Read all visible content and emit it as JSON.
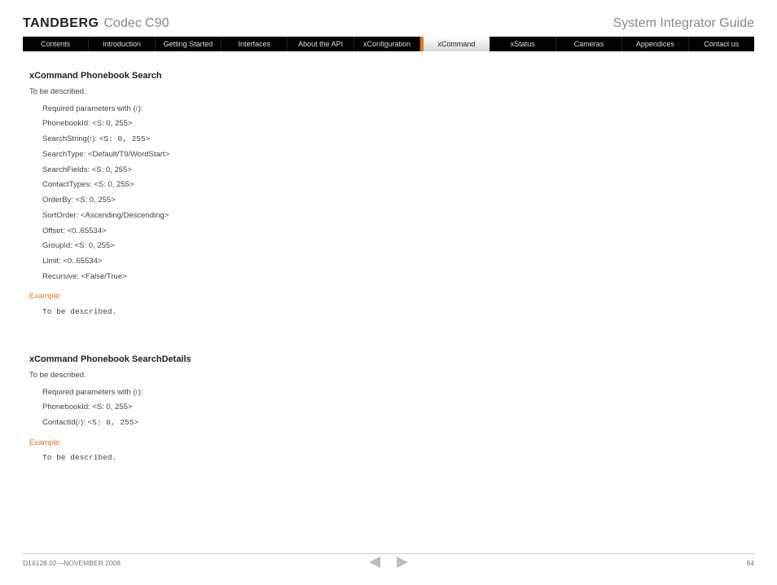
{
  "header": {
    "brand": "TANDBERG",
    "product": "Codec C90",
    "guide": "System Integrator Guide"
  },
  "nav": {
    "items": [
      "Contents",
      "Introduction",
      "Getting Started",
      "Interfaces",
      "About the API",
      "xConfiguration",
      "xCommand",
      "xStatus",
      "Cameras",
      "Appendices",
      "Contact us"
    ],
    "active_index": 6
  },
  "section1": {
    "title": "xCommand Phonebook Search",
    "desc": "To be described.",
    "req_label_pre": "Required parameters with (",
    "req_label_r": "r",
    "req_label_post": "):",
    "params": [
      {
        "text": "PhonebookId: <S: 0, 255>"
      },
      {
        "pre": "SearchString(",
        "r": "r",
        "post": "):  ",
        "mono": "<S: 0, 255>"
      },
      {
        "text": "SearchType: <Default/T9/WordStart>"
      },
      {
        "text": "SearchFields: <S: 0, 255>"
      },
      {
        "text": "ContactTypes: <S: 0, 255>"
      },
      {
        "text": "OrderBy: <S: 0, 255>"
      },
      {
        "text": "SortOrder: <Ascending/Descending>"
      },
      {
        "text": "Offset: <0..65534>"
      },
      {
        "text": "GroupId: <S: 0, 255>"
      },
      {
        "text": "Limit: <0..65534>"
      },
      {
        "text": "Recursive: <False/True>"
      }
    ],
    "example_label": "Example:",
    "example_body": "To be described."
  },
  "section2": {
    "title": "xCommand Phonebook SearchDetails",
    "desc": "To be described.",
    "req_label_pre": "Required parameters with (",
    "req_label_r": "r",
    "req_label_post": "):",
    "params": [
      {
        "text": "PhonebookId: <S: 0, 255>"
      },
      {
        "pre": "ContactId(",
        "r": "r",
        "post": "): ",
        "mono": "<S: 0, 255>"
      }
    ],
    "example_label": "Example:",
    "example_body": "To be described."
  },
  "footer": {
    "left": "D14128.02—NOVEMBER 2008",
    "page": "84"
  }
}
